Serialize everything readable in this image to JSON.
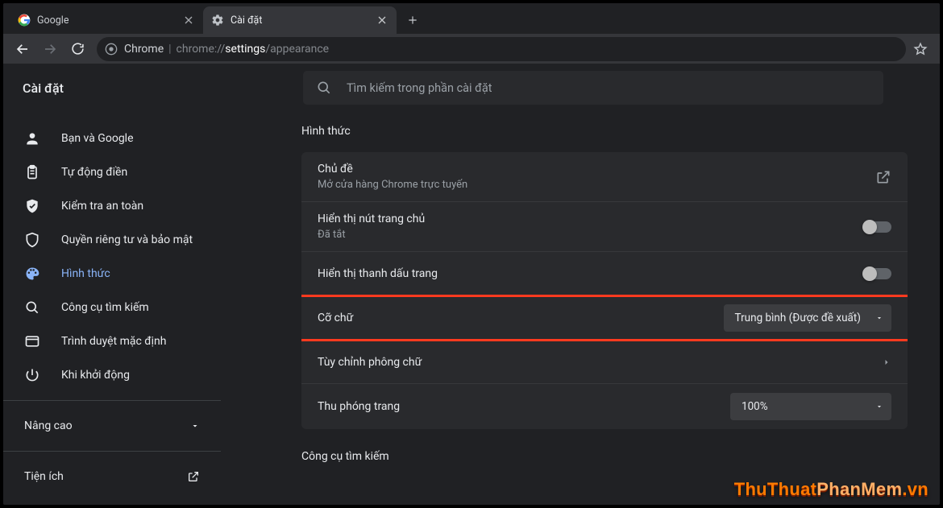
{
  "tabs": [
    {
      "title": "Google"
    },
    {
      "title": "Cài đặt"
    }
  ],
  "toolbar": {
    "scheme_label": "Chrome",
    "url_pre": "chrome://",
    "url_mid": "settings",
    "url_post": "/appearance"
  },
  "page": {
    "title": "Cài đặt",
    "search_placeholder": "Tìm kiếm trong phần cài đặt"
  },
  "sidebar": {
    "items": [
      {
        "label": "Bạn và Google"
      },
      {
        "label": "Tự động điền"
      },
      {
        "label": "Kiểm tra an toàn"
      },
      {
        "label": "Quyền riêng tư và bảo mật"
      },
      {
        "label": "Hình thức"
      },
      {
        "label": "Công cụ tìm kiếm"
      },
      {
        "label": "Trình duyệt mặc định"
      },
      {
        "label": "Khi khởi động"
      }
    ],
    "advanced": "Nâng cao",
    "extensions": "Tiện ích"
  },
  "section_appearance": {
    "title": "Hình thức",
    "theme_label": "Chủ đề",
    "theme_sub": "Mở cửa hàng Chrome trực tuyến",
    "home_button_label": "Hiển thị nút trang chủ",
    "home_button_sub": "Đã tắt",
    "bookmarks_bar_label": "Hiển thị thanh dấu trang",
    "font_size_label": "Cỡ chữ",
    "font_size_value": "Trung bình (Được đề xuất)",
    "customize_fonts_label": "Tùy chỉnh phông chữ",
    "zoom_label": "Thu phóng trang",
    "zoom_value": "100%"
  },
  "section_search": {
    "title": "Công cụ tìm kiếm"
  },
  "watermark": {
    "a": "ThuThuat",
    "b": "PhanMem",
    "c": ".vn"
  }
}
